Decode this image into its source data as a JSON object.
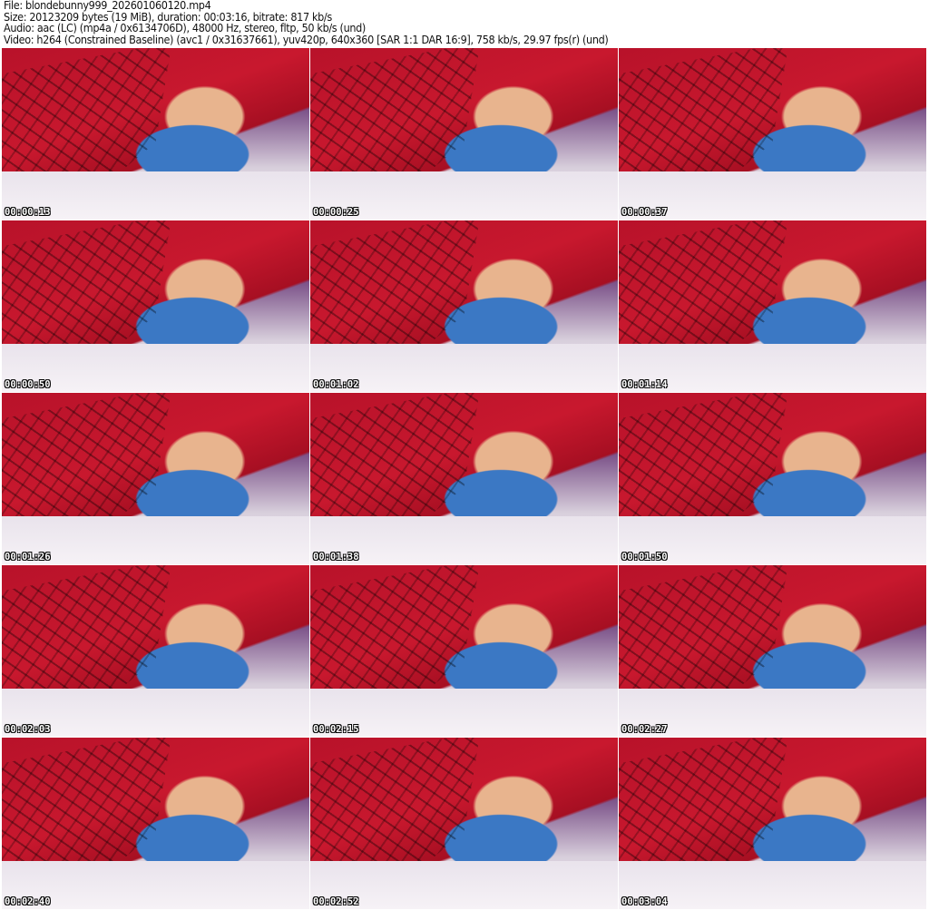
{
  "header": {
    "file": "File: blondebunny999_202601060120.mp4",
    "size": "Size: 20123209 bytes (19 MiB), duration: 00:03:16, bitrate: 817 kb/s",
    "audio": "Audio: aac (LC) (mp4a / 0x6134706D), 48000 Hz, stereo, fltp, 50 kb/s (und)",
    "video": "Video: h264 (Constrained Baseline) (avc1 / 0x31637661), yuv420p, 640x360 [SAR 1:1 DAR 16:9], 758 kb/s, 29.97 fps(r) (und)"
  },
  "thumbnails": [
    {
      "timestamp": "00:00:13"
    },
    {
      "timestamp": "00:00:25"
    },
    {
      "timestamp": "00:00:37"
    },
    {
      "timestamp": "00:00:50"
    },
    {
      "timestamp": "00:01:02"
    },
    {
      "timestamp": "00:01:14"
    },
    {
      "timestamp": "00:01:26"
    },
    {
      "timestamp": "00:01:38"
    },
    {
      "timestamp": "00:01:50"
    },
    {
      "timestamp": "00:02:03"
    },
    {
      "timestamp": "00:02:15"
    },
    {
      "timestamp": "00:02:27"
    },
    {
      "timestamp": "00:02:40"
    },
    {
      "timestamp": "00:02:52"
    },
    {
      "timestamp": "00:03:04"
    }
  ]
}
